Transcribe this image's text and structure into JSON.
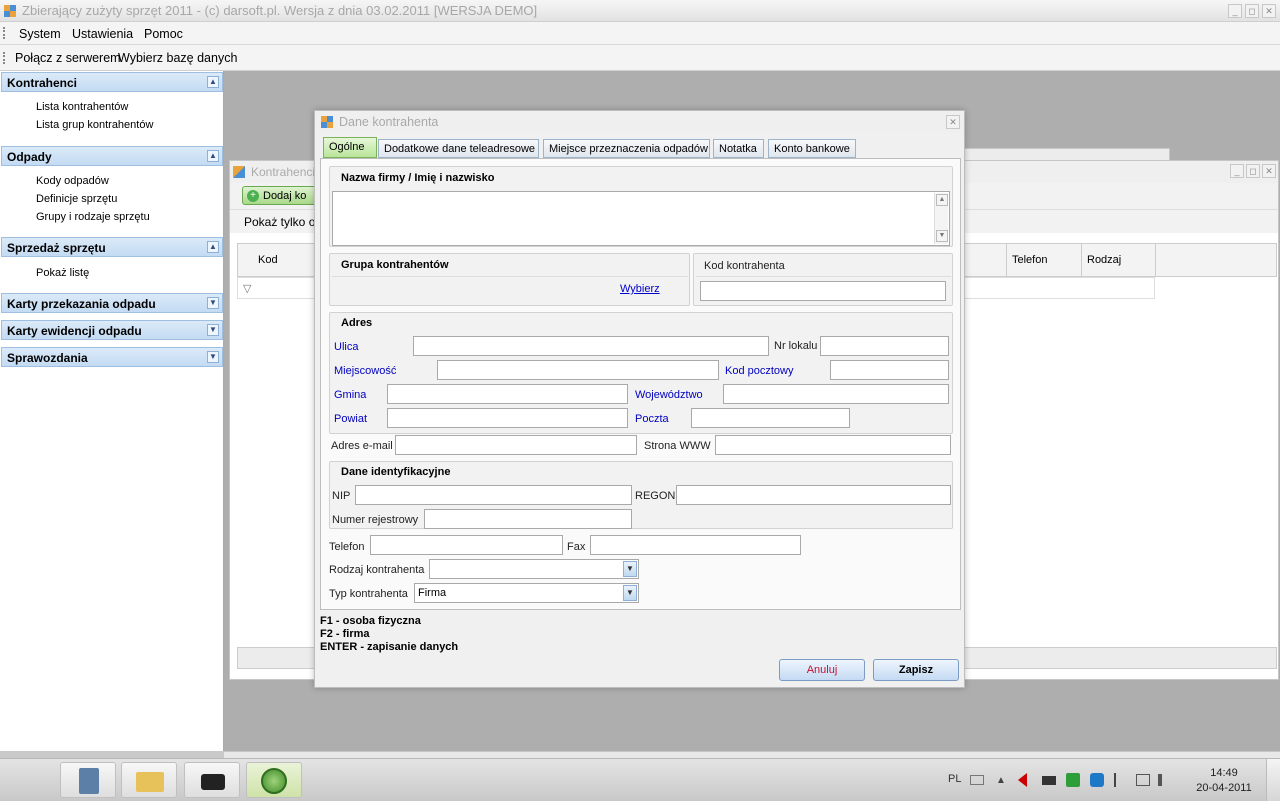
{
  "app": {
    "title": "Zbierający zużyty sprzęt 2011 - (c) darsoft.pl. Wersja z dnia 03.02.2011 [WERSJA DEMO]",
    "window_buttons": [
      "_",
      "◻",
      "✕"
    ]
  },
  "menu": {
    "items": [
      "System",
      "Ustawienia",
      "Pomoc"
    ]
  },
  "toolbar": {
    "connect": "Połącz z serwerem",
    "choose_db": "Wybierz bazę danych"
  },
  "sidebar": {
    "sections": [
      {
        "title": "Kontrahenci",
        "items": [
          "Lista kontrahentów",
          "Lista grup kontrahentów"
        ]
      },
      {
        "title": "Odpady",
        "items": [
          "Kody odpadów",
          "Definicje sprzętu",
          "Grupy i rodzaje sprzętu"
        ]
      },
      {
        "title": "Sprzedaż sprzętu",
        "items": [
          "Pokaż listę"
        ]
      },
      {
        "title": "Karty przekazania odpadu",
        "items": []
      },
      {
        "title": "Karty ewidencji odpadu",
        "items": []
      },
      {
        "title": "Sprawozdania",
        "items": []
      }
    ],
    "expanded_glyph": "▲",
    "collapsed_glyph": "▼"
  },
  "bg_window": {
    "title": "Kontrahenci",
    "add_button": "Dodaj ko",
    "filter": "Pokaż tylko o",
    "columns": [
      "Kod",
      "Telefon",
      "Rodzaj"
    ],
    "filter_glyph": "▽"
  },
  "dialog": {
    "title": "Dane kontrahenta",
    "tabs": [
      "Ogólne",
      "Dodatkowe dane teleadresowe",
      "Miejsce przeznaczenia odpadów",
      "Notatka",
      "Konto bankowe"
    ],
    "name_group": {
      "title": "Nazwa firmy / Imię i nazwisko",
      "value": ""
    },
    "client_group": {
      "title": "Grupa kontrahentów",
      "choose": "Wybierz"
    },
    "code_group": {
      "title": "Kod kontrahenta",
      "value": ""
    },
    "address": {
      "title": "Adres",
      "street": "Ulica",
      "apt": "Nr lokalu",
      "city": "Miejscowość",
      "zip": "Kod pocztowy",
      "commune": "Gmina",
      "voivodeship": "Województwo",
      "county": "Powiat",
      "post": "Poczta"
    },
    "email_label": "Adres e-mail",
    "www_label": "Strona WWW",
    "ident": {
      "title": "Dane identyfikacyjne",
      "nip": "NIP",
      "regon": "REGON",
      "reg_no": "Numer rejestrowy"
    },
    "phone_label": "Telefon",
    "fax_label": "Fax",
    "kind_label": "Rodzaj kontrahenta",
    "kind_value": "",
    "type_label": "Typ kontrahenta",
    "type_value": "Firma",
    "hints": [
      "F1 - osoba fizyczna",
      "F2 - firma",
      "ENTER - zapisanie danych"
    ],
    "cancel": "Anuluj",
    "save": "Zapisz"
  },
  "taskbar": {
    "lang": "PL",
    "time": "14:49",
    "date": "20-04-2011"
  },
  "colors": {
    "accent_blue": "#0000c0",
    "tab_active_green": "#b9e59a",
    "section_header": "#c4dbf3",
    "cancel_text": "#c8102e"
  }
}
